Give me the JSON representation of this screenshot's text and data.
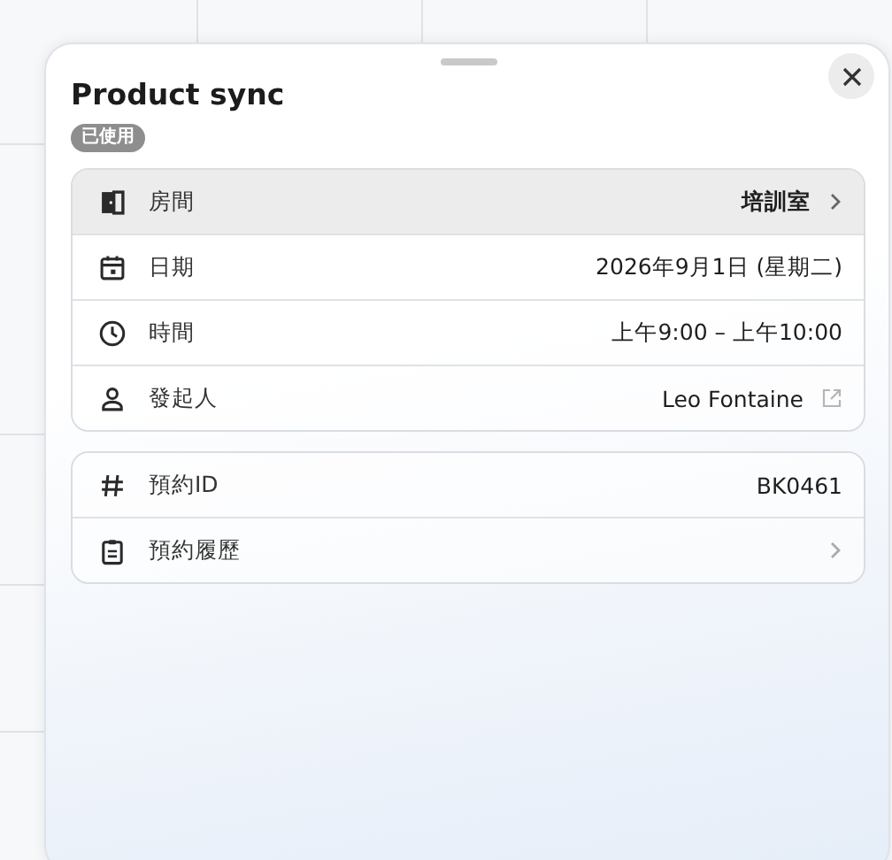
{
  "sheet": {
    "title": "Product sync",
    "badge": "已使用"
  },
  "groups": [
    {
      "rows": [
        {
          "label": "房間",
          "value": "培訓室",
          "kind": "link",
          "selected": true
        },
        {
          "label": "日期",
          "value": "2026年9月1日 (星期二)",
          "kind": "plain",
          "selected": false
        },
        {
          "label": "時間",
          "value": "上午9:00 – 上午10:00",
          "kind": "plain",
          "selected": false
        },
        {
          "label": "發起人",
          "value": "Leo Fontaine",
          "kind": "external",
          "selected": false
        }
      ]
    },
    {
      "rows": [
        {
          "label": "預約ID",
          "value": "BK0461",
          "kind": "plain",
          "selected": false
        },
        {
          "label": "預約履歷",
          "kind": "link",
          "selected": false
        }
      ]
    }
  ]
}
